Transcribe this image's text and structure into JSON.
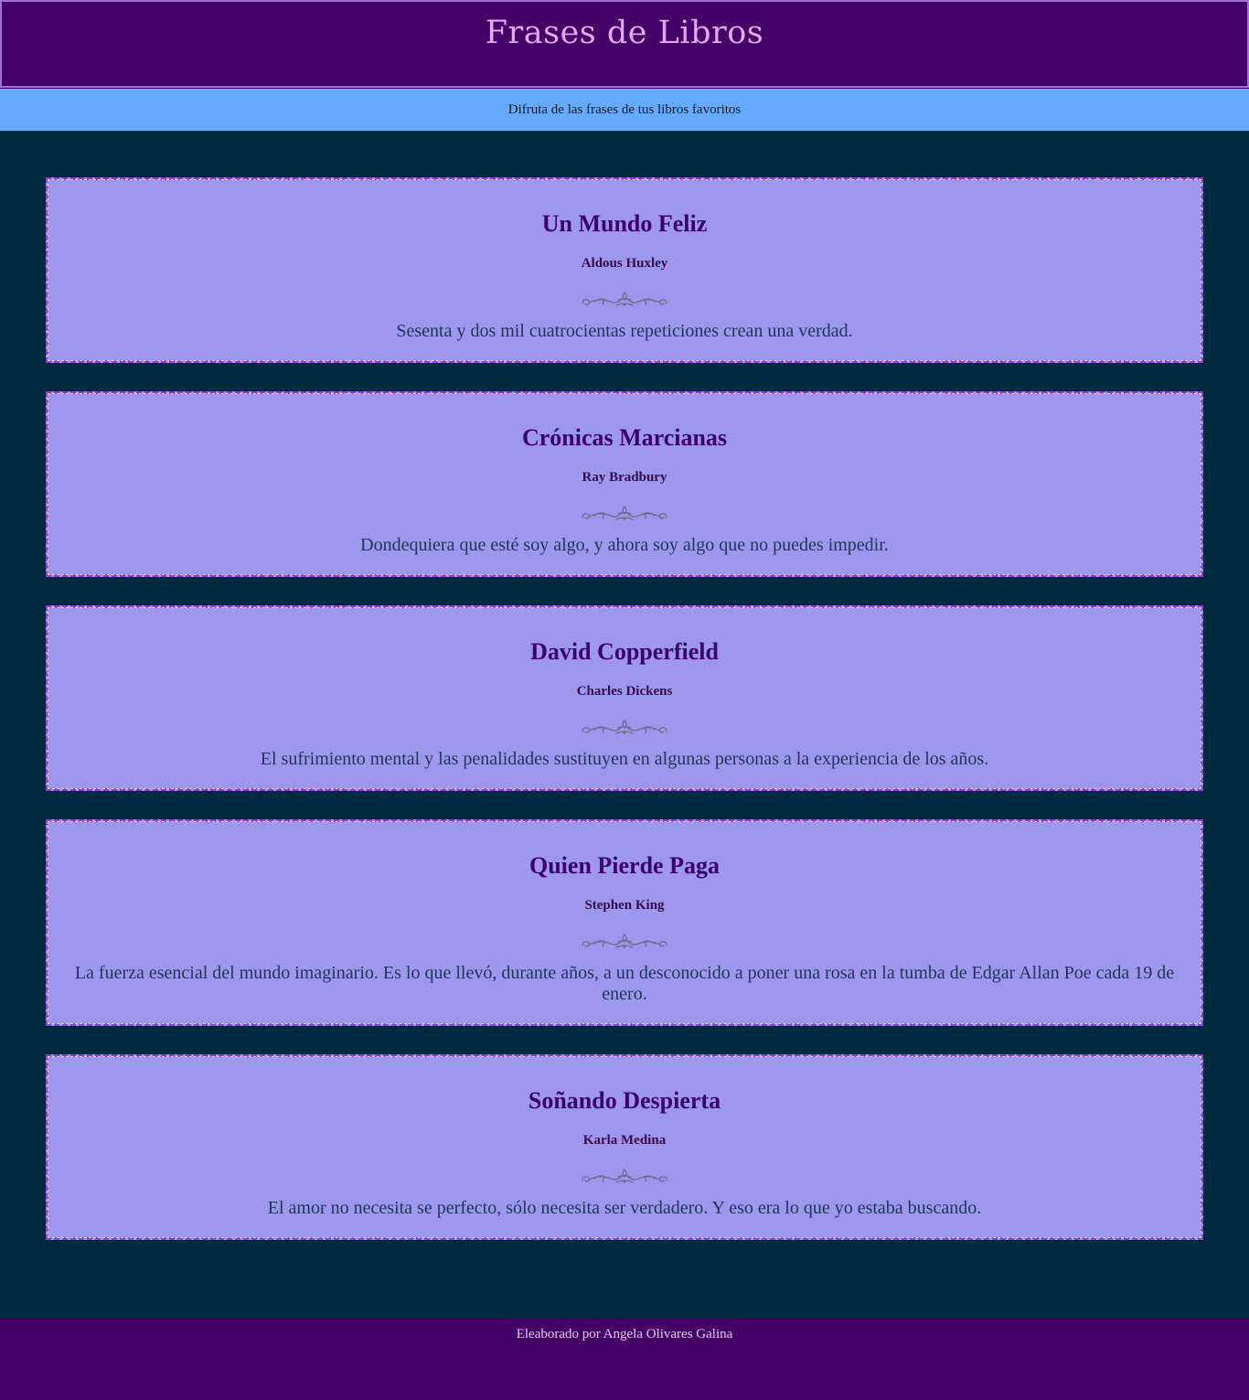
{
  "header": {
    "title": "Frases de Libros",
    "subtitle": "Difruta de las frases de tus libros favoritos"
  },
  "quotes": [
    {
      "title": "Un Mundo Feliz",
      "author": "Aldous Huxley",
      "quote": "Sesenta y dos mil cuatrocientas repeticiones crean una verdad."
    },
    {
      "title": "Crónicas Marcianas",
      "author": "Ray Bradbury",
      "quote": "Dondequiera que esté soy algo, y ahora soy algo que no puedes impedir."
    },
    {
      "title": "David Copperfield",
      "author": "Charles Dickens",
      "quote": "El sufrimiento mental y las penalidades sustituyen en algunas personas a la experiencia de los años."
    },
    {
      "title": "Quien Pierde Paga",
      "author": "Stephen King",
      "quote": "La fuerza esencial del mundo imaginario. Es lo que llevó, durante años, a un desconocido a poner una rosa en la tumba de Edgar Allan Poe cada 19 de enero."
    },
    {
      "title": "Soñando Despierta",
      "author": "Karla Medina",
      "quote": "El amor no necesita se perfecto, sólo necesita ser verdadero. Y eso era lo que yo estaba buscando."
    }
  ],
  "footer": {
    "text": "Eleaborado por Angela Olivares Galina"
  },
  "colors": {
    "page_background": "#002a40",
    "header_background": "#440066",
    "title_color": "#e6a6f2",
    "subtitle_background": "#66aaff",
    "card_background": "#9d98ee",
    "card_border": "#8a3fd0",
    "book_title_color": "#3d0066",
    "quote_color": "#1f3557"
  },
  "icons": {
    "divider": "ornamental-flourish-divider-icon"
  }
}
